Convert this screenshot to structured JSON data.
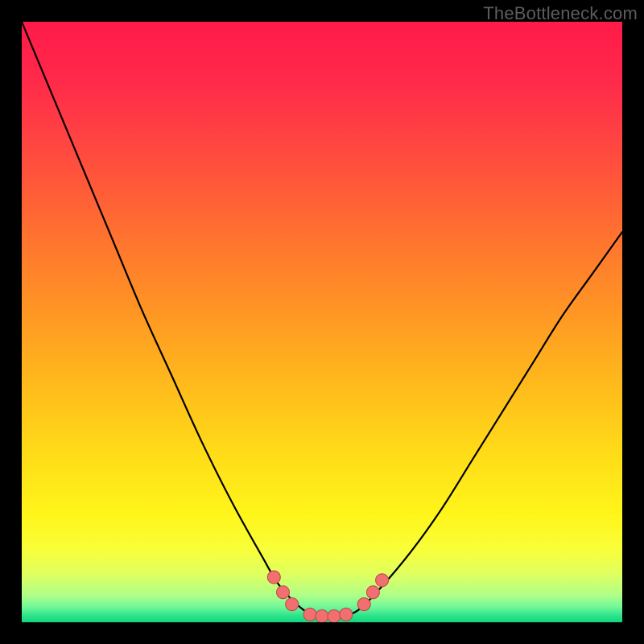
{
  "attribution": "TheBottleneck.com",
  "chart_data": {
    "type": "line",
    "title": "",
    "xlabel": "",
    "ylabel": "",
    "xlim": [
      0,
      100
    ],
    "ylim": [
      0,
      100
    ],
    "series": [
      {
        "name": "bottleneck-curve",
        "x": [
          0,
          5,
          10,
          15,
          20,
          25,
          30,
          35,
          40,
          43,
          47,
          50,
          53,
          56,
          60,
          65,
          70,
          75,
          80,
          85,
          90,
          95,
          100
        ],
        "y": [
          100,
          88,
          76,
          64,
          52,
          41,
          30,
          20,
          11,
          6,
          2,
          1,
          1,
          2,
          6,
          12,
          19,
          27,
          35,
          43,
          51,
          58,
          65
        ]
      }
    ],
    "markers": [
      {
        "name": "left-marker-1",
        "x": 42.0,
        "y": 7.5
      },
      {
        "name": "left-marker-2",
        "x": 43.5,
        "y": 5.0
      },
      {
        "name": "left-marker-3",
        "x": 45.0,
        "y": 3.0
      },
      {
        "name": "flat-marker-1",
        "x": 48.0,
        "y": 1.3
      },
      {
        "name": "flat-marker-2",
        "x": 50.0,
        "y": 1.0
      },
      {
        "name": "flat-marker-3",
        "x": 52.0,
        "y": 1.0
      },
      {
        "name": "flat-marker-4",
        "x": 54.0,
        "y": 1.3
      },
      {
        "name": "right-marker-1",
        "x": 57.0,
        "y": 3.0
      },
      {
        "name": "right-marker-2",
        "x": 58.5,
        "y": 5.0
      },
      {
        "name": "right-marker-3",
        "x": 60.0,
        "y": 7.0
      }
    ],
    "gradient_stops": [
      {
        "pos": 0.0,
        "color": "#ff1a4a"
      },
      {
        "pos": 0.1,
        "color": "#ff2a4a"
      },
      {
        "pos": 0.22,
        "color": "#ff4a3f"
      },
      {
        "pos": 0.35,
        "color": "#ff7030"
      },
      {
        "pos": 0.48,
        "color": "#ff9524"
      },
      {
        "pos": 0.6,
        "color": "#ffb91c"
      },
      {
        "pos": 0.72,
        "color": "#ffdc18"
      },
      {
        "pos": 0.82,
        "color": "#fff51a"
      },
      {
        "pos": 0.88,
        "color": "#f8ff3a"
      },
      {
        "pos": 0.92,
        "color": "#dfff60"
      },
      {
        "pos": 0.955,
        "color": "#b0ff88"
      },
      {
        "pos": 0.975,
        "color": "#70f79a"
      },
      {
        "pos": 0.99,
        "color": "#28e28a"
      },
      {
        "pos": 1.0,
        "color": "#13d57d"
      }
    ],
    "marker_style": {
      "fill": "#f07070",
      "stroke": "#c04545",
      "r": 8
    }
  }
}
